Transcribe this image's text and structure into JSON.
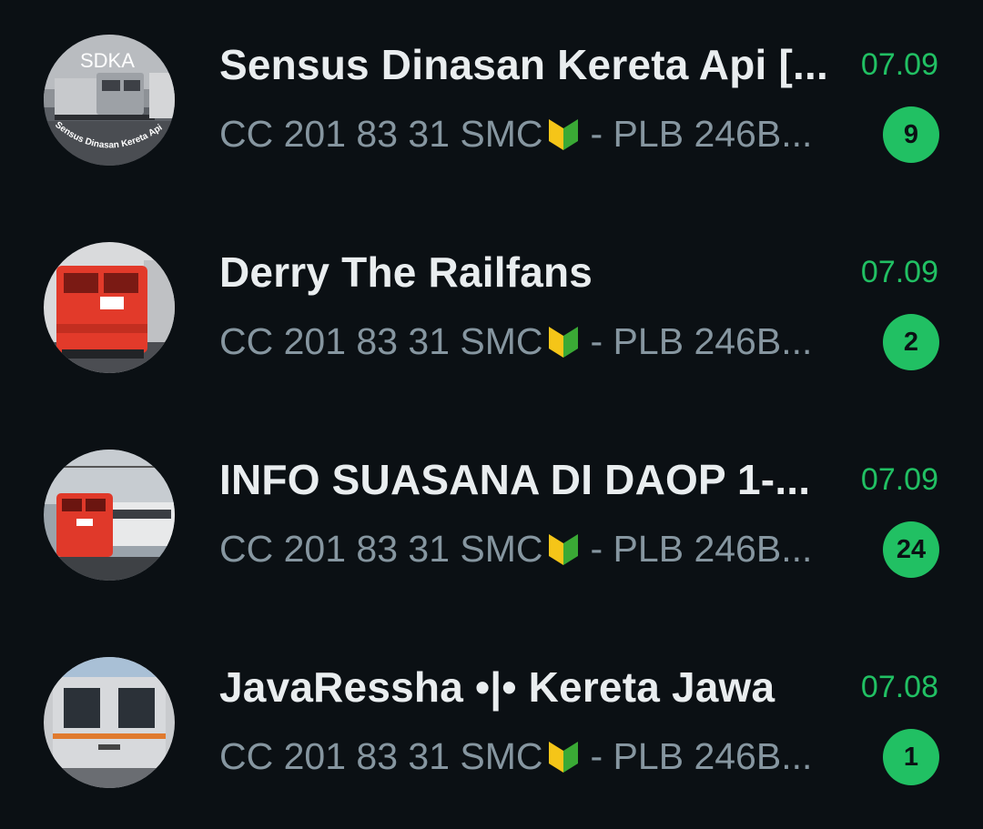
{
  "colors": {
    "background": "#0b1014",
    "title": "#e9edef",
    "preview": "#8696a0",
    "accent": "#21c063"
  },
  "chats": [
    {
      "title": "Sensus Dinasan Kereta Api [...",
      "avatar_label": "SDKA",
      "avatar_caption": "Sensus Dinasan Kereta Api",
      "preview_text": "CC 201 83 31 SMC",
      "preview_icon": "beginner-badge-icon",
      "preview_suffix": "- PLB 246B...",
      "time": "07.09",
      "unread": "9"
    },
    {
      "title": "Derry The Railfans",
      "avatar_label": "",
      "preview_text": "CC 201 83 31 SMC",
      "preview_icon": "beginner-badge-icon",
      "preview_suffix": "- PLB 246B...",
      "time": "07.09",
      "unread": "2"
    },
    {
      "title": "INFO SUASANA DI DAOP 1-...",
      "avatar_label": "",
      "preview_text": "CC 201 83 31 SMC",
      "preview_icon": "beginner-badge-icon",
      "preview_suffix": "- PLB 246B...",
      "time": "07.09",
      "unread": "24"
    },
    {
      "title": "JavaRessha •|• Kereta Jawa",
      "avatar_label": "",
      "preview_text": "CC 201 83 31 SMC",
      "preview_icon": "beginner-badge-icon",
      "preview_suffix": "- PLB 246B...",
      "time": "07.08",
      "unread": "1"
    }
  ]
}
